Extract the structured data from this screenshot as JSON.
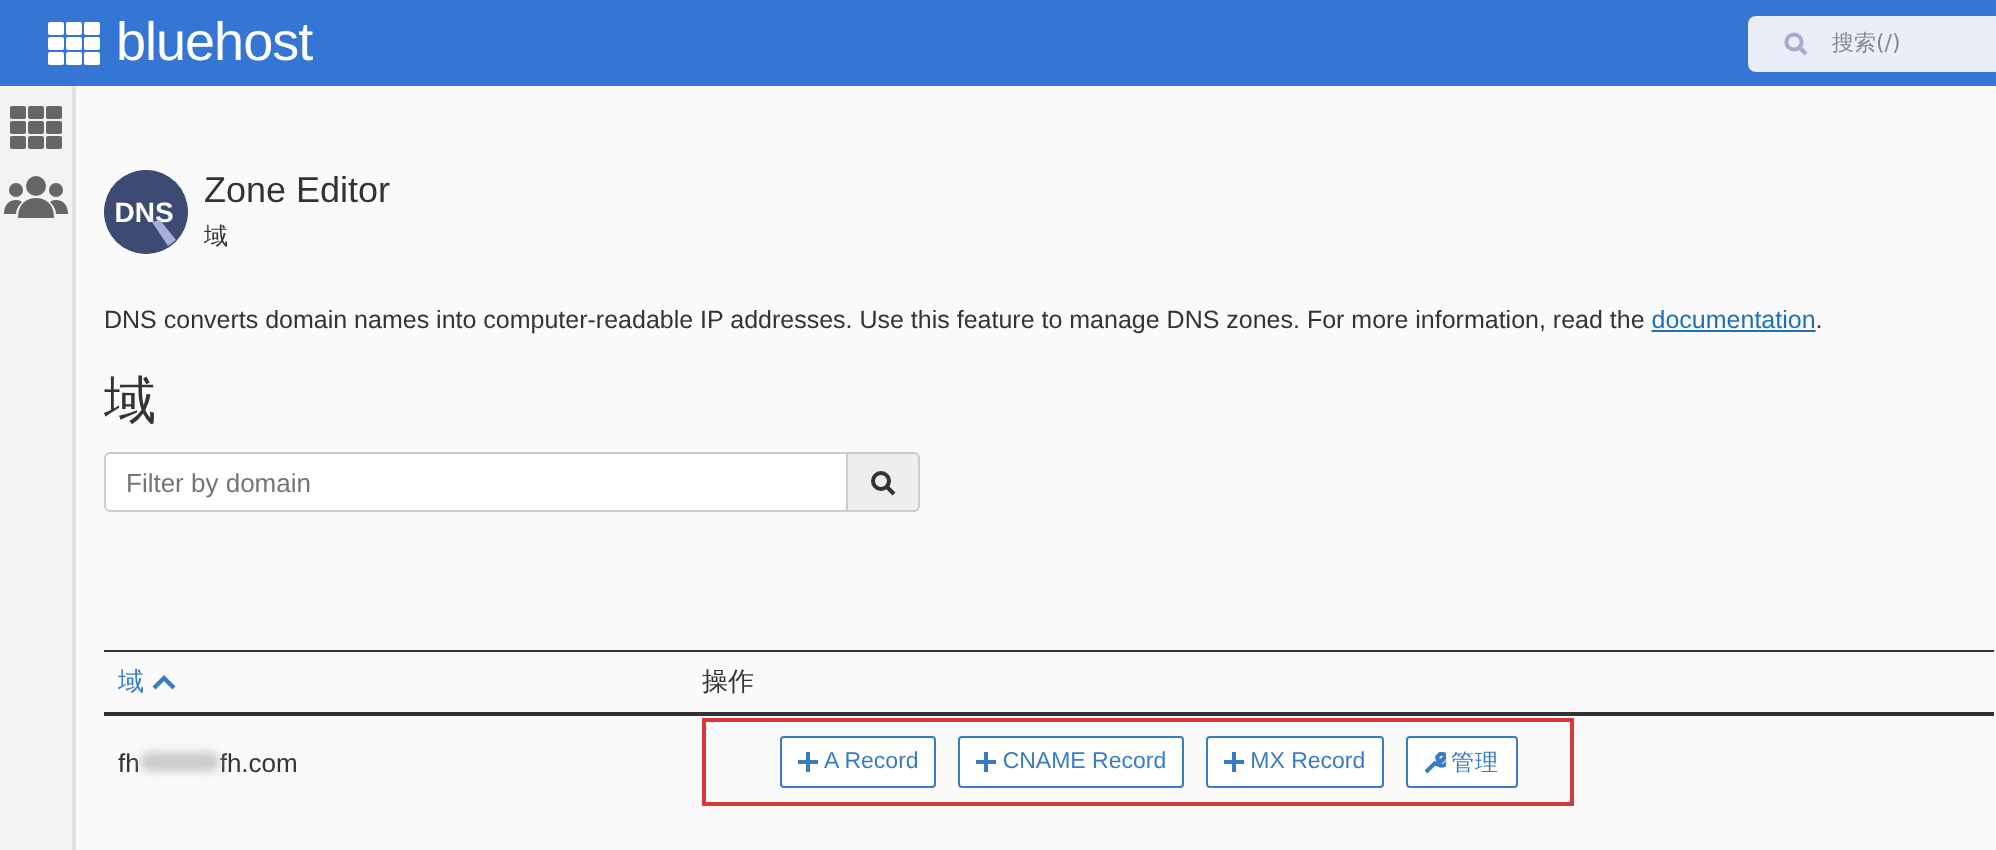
{
  "header": {
    "logo_text": "bluehost",
    "search": {
      "placeholder": "搜索(/)"
    }
  },
  "sidebar": {
    "items": [
      {
        "kind": "grid",
        "selected": false
      },
      {
        "kind": "users",
        "selected": false
      }
    ]
  },
  "page": {
    "icon_label": "DNS",
    "title": "Zone Editor",
    "subtitle": "域",
    "description": "DNS converts domain names into computer-readable IP addresses. Use this feature to manage DNS zones. For more information, read the ",
    "description_link": "documentation",
    "description_end": "."
  },
  "section": {
    "heading": "域",
    "filter": {
      "placeholder": "Filter by domain"
    }
  },
  "table": {
    "columns": [
      {
        "label": "域",
        "sorted": true
      },
      {
        "label": "操作",
        "sorted": false
      }
    ],
    "rows": [
      {
        "domain_start": "fh",
        "domain_end": "fh.com",
        "actions": [
          {
            "kind": "add",
            "label": "A Record"
          },
          {
            "kind": "add",
            "label": "CNAME Record"
          },
          {
            "kind": "add",
            "label": "MX Record"
          },
          {
            "kind": "manage",
            "label": "管理"
          }
        ]
      }
    ]
  }
}
